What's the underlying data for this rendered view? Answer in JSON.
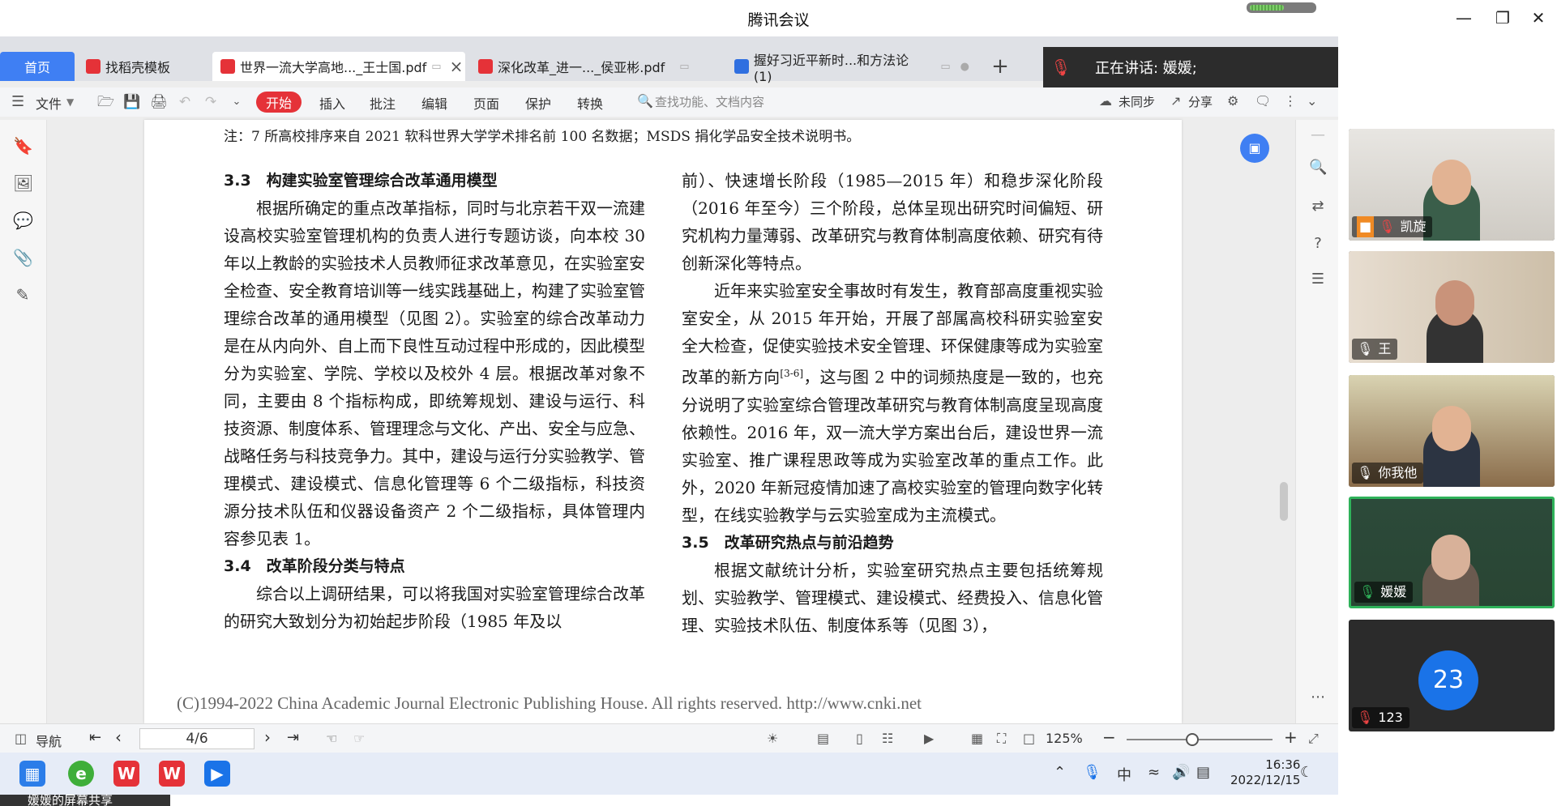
{
  "window": {
    "title": "腾讯会议"
  },
  "tabs": {
    "home": "首页",
    "items": [
      {
        "label": "找稻壳模板"
      },
      {
        "label": "世界一流大学高地..._王士国.pdf"
      },
      {
        "label": "深化改革_进一..._侯亚彬.pdf"
      },
      {
        "label": "握好习近平新时...和方法论(1)"
      }
    ]
  },
  "speaker": {
    "text": "正在讲话: 媛媛;"
  },
  "toolbar": {
    "file": "文件",
    "start": "开始",
    "insert": "插入",
    "annotate": "批注",
    "edit": "编辑",
    "page": "页面",
    "protect": "保护",
    "convert": "转换",
    "search_placeholder": "查找功能、文档内容",
    "unsynced": "未同步",
    "share": "分享"
  },
  "document": {
    "note": "注：7 所高校排序来自 2021 软科世界大学学术排名前 100 名数据；MSDS 捐化学品安全技术说明书。",
    "left": {
      "h33": "3.3　构建实验室管理综合改革通用模型",
      "p1": "根据所确定的重点改革指标，同时与北京若干双一流建设高校实验室管理机构的负责人进行专题访谈，向本校 30 年以上教龄的实验技术人员教师征求改革意见，在实验室安全检查、安全教育培训等一线实践基础上，构建了实验室管理综合改革的通用模型（见图 2）。实验室的综合改革动力是在从内向外、自上而下良性互动过程中形成的，因此模型分为实验室、学院、学校以及校外 4 层。根据改革对象不同，主要由 8 个指标构成，即统筹规划、建设与运行、科技资源、制度体系、管理理念与文化、产出、安全与应急、战略任务与科技竞争力。其中，建设与运行分实验教学、管理模式、建设模式、信息化管理等 6 个二级指标，科技资源分技术队伍和仪器设备资产 2 个二级指标，具体管理内容参见表 1。",
      "h34": "3.4　改革阶段分类与特点",
      "p2": "综合以上调研结果，可以将我国对实验室管理综合改革的研究大致划分为初始起步阶段（1985 年及以"
    },
    "right": {
      "p1": "前）、快速增长阶段（1985—2015 年）和稳步深化阶段（2016 年至今）三个阶段，总体呈现出研究时间偏短、研究机构力量薄弱、改革研究与教育体制高度依赖、研究有待创新深化等特点。",
      "p2a": "近年来实验室安全事故时有发生，教育部高度重视实验室安全，从 2015 年开始，开展了部属高校科研实验室安全大检查，促使实验技术安全管理、环保健康等成为实验室改革的新方向",
      "cite": "[3-6]",
      "p2b": "，这与图 2 中的词频热度是一致的，也充分说明了实验室综合管理改革研究与教育体制高度呈现高度依赖性。2016 年，双一流大学方案出台后，建设世界一流实验室、推广课程思政等成为实验室改革的重点工作。此外，2020 年新冠疫情加速了高校实验室的管理向数字化转型，在线实验教学与云实验室成为主流模式。",
      "h35": "3.5　改革研究热点与前沿趋势",
      "p3": "根据文献统计分析，实验室研究热点主要包括统筹规划、实验教学、管理模式、建设模式、经费投入、信息化管理、实验技术队伍、制度体系等（见图 3），"
    },
    "footer": "(C)1994-2022 China Academic Journal Electronic Publishing House. All rights reserved.    http://www.cnki.net"
  },
  "statusbar": {
    "nav": "导航",
    "page": "4/6",
    "zoom": "125%",
    "zoom_level_fraction": 0.45
  },
  "taskbar": {
    "time": "16:36",
    "date": "2022/12/15",
    "ime": "中",
    "share_label": "媛媛的屏幕共享"
  },
  "participants": [
    {
      "name": "凯旋"
    },
    {
      "name": "王"
    },
    {
      "name": "你我他"
    },
    {
      "name": "媛媛"
    },
    {
      "name": "123",
      "avatar_text": "23"
    }
  ]
}
